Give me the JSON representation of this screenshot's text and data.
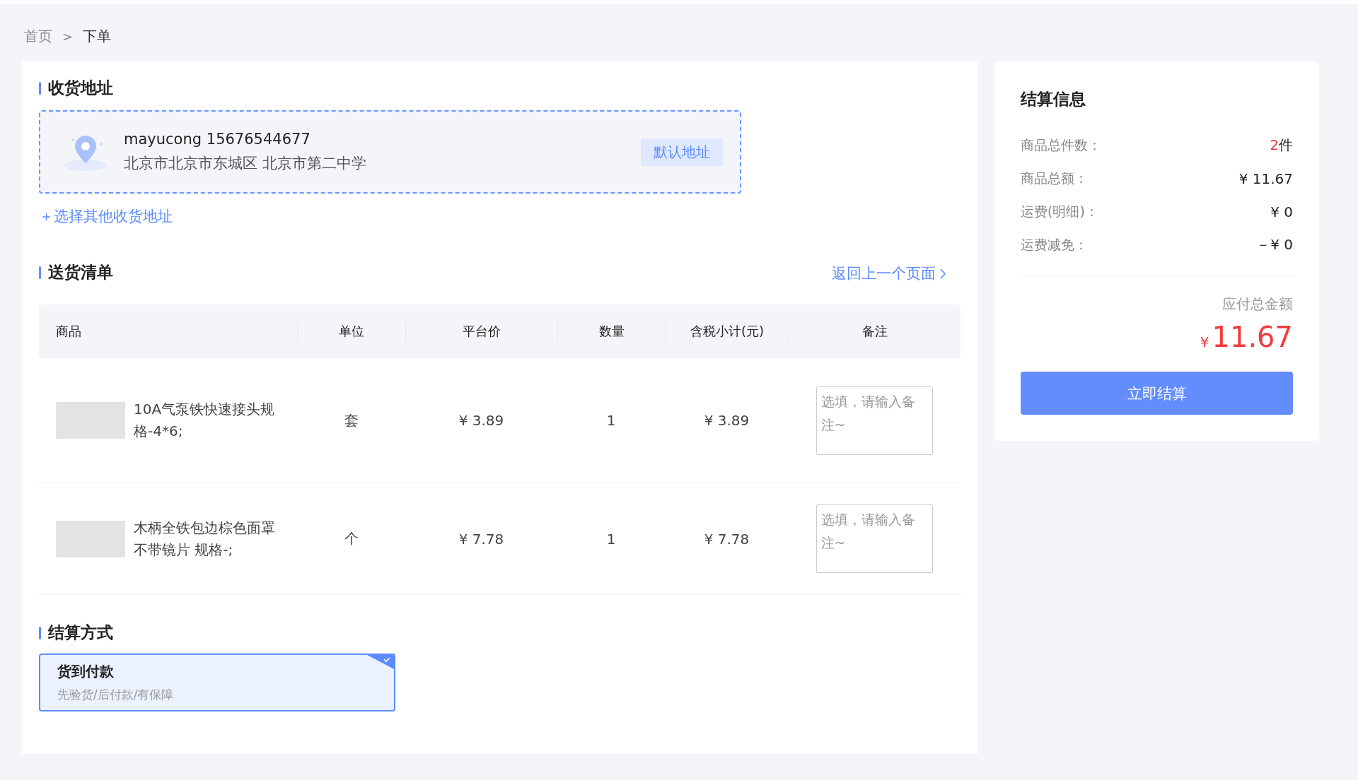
{
  "breadcrumb": [
    {
      "label": "首页",
      "current": false
    },
    {
      "label": "下单",
      "current": true
    }
  ],
  "breadcrumb_separator": ">",
  "address_section": {
    "title": "收货地址",
    "address": {
      "name_phone": "mayucong 15676544677",
      "detail": "北京市北京市东城区 北京市第二中学",
      "tag": "默认地址"
    },
    "other_link": "＋选择其他收货地址"
  },
  "delivery_section": {
    "title": "送货清单",
    "back_link": "返回上一个页面",
    "columns": [
      "商品",
      "单位",
      "平台价",
      "数量",
      "含税小计(元)",
      "备注"
    ],
    "rows": [
      {
        "name": "10A气泵铁快速接头规格-4*6;",
        "unit": "套",
        "price": "¥ 3.89",
        "quantity": "1",
        "subtotal": "¥ 3.89",
        "remark_placeholder": "选填，请输入备注~"
      },
      {
        "name": "木柄全铁包边棕色面罩不带镜片 规格-;",
        "unit": "个",
        "price": "¥ 7.78",
        "quantity": "1",
        "subtotal": "¥ 7.78",
        "remark_placeholder": "选填，请输入备注~"
      }
    ]
  },
  "payment_section": {
    "title": "结算方式",
    "methods": [
      {
        "name": "货到付款",
        "description": "先验货/后付款/有保障",
        "selected": true
      }
    ]
  },
  "summary": {
    "title": "结算信息",
    "rows": [
      {
        "kind": "count",
        "label": "商品总件数：",
        "number": "2",
        "unit": "件"
      },
      {
        "kind": "plain",
        "label": "商品总额：",
        "value": "¥ 11.67"
      },
      {
        "kind": "plain",
        "label": "运费(明细)：",
        "value": "¥ 0"
      },
      {
        "kind": "plain",
        "label": "运费减免：",
        "value": "－¥ 0"
      }
    ],
    "total_label": "应付总金额",
    "total_currency": "¥",
    "total_amount": "11.67",
    "submit_button": "立即结算"
  }
}
